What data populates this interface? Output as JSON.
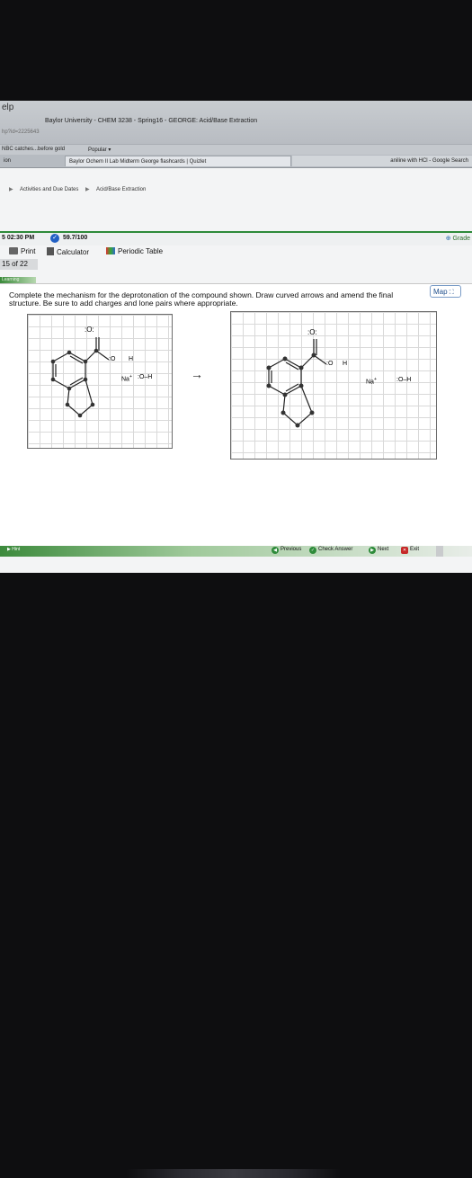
{
  "browser": {
    "help_label": "elp",
    "window_title": "Baylor University - CHEM 3238 - Spring16 - GEORGE: Acid/Base Extraction",
    "url_fragment": "hp?id=2225643",
    "bookmarks": [
      "NBC catches...before gold",
      "Popular ▾"
    ],
    "tabs": {
      "left": "ion",
      "active": "Baylor Ochem II Lab Midterm George flashcards | Quizlet",
      "right": "aniline with HCl - Google Search"
    }
  },
  "breadcrumb": [
    "Activities and Due Dates",
    "Acid/Base Extraction"
  ],
  "status": {
    "time": "5 02:30 PM",
    "score": "59.7/100",
    "grade_label": "Grade"
  },
  "toolbar": {
    "print": "Print",
    "calculator": "Calculator",
    "periodic_table": "Periodic Table"
  },
  "progress": "15 of 22",
  "learning_tag": "Learning",
  "map_button": "Map",
  "question": {
    "text": "Complete the mechanism for the deprotonation of the compound shown. Draw curved arrows and amend the final structure. Be sure to add charges and lone pairs where appropriate."
  },
  "structure_labels": {
    "carbonyl_o": ":O:",
    "oh_h": "H",
    "na": "Na",
    "na_charge": "+",
    "hydroxide": ":O–H"
  },
  "footer": {
    "hint": "Hint",
    "previous": "Previous",
    "check_answer": "Check Answer",
    "next": "Next",
    "exit": "Exit"
  },
  "colors": {
    "accent_green": "#2e8b3a",
    "link_blue": "#1f4e8c"
  }
}
